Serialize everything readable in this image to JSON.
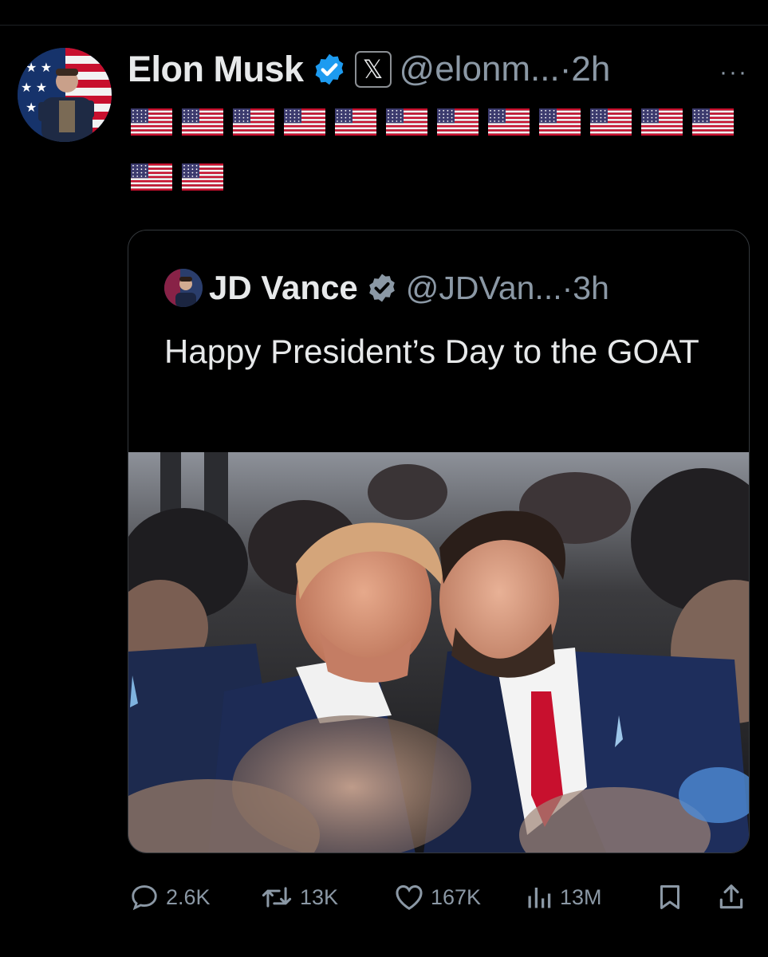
{
  "tweet": {
    "author_name": "Elon Musk",
    "handle_time": "@elonm...·2h",
    "more_icon": "more-icon",
    "flag_emoji_count": 14,
    "flag_emoji": "🇺🇸"
  },
  "quoted": {
    "author_name": "JD Vance",
    "handle_time": "@JDVan...·3h",
    "text": "Happy President’s Day to the GOAT"
  },
  "actions": {
    "replies": "2.6K",
    "reposts": "13K",
    "likes": "167K",
    "views": "13M"
  },
  "colors": {
    "background": "#000000",
    "verified_blue": "#1d9bf0",
    "muted": "#8b98a5"
  }
}
